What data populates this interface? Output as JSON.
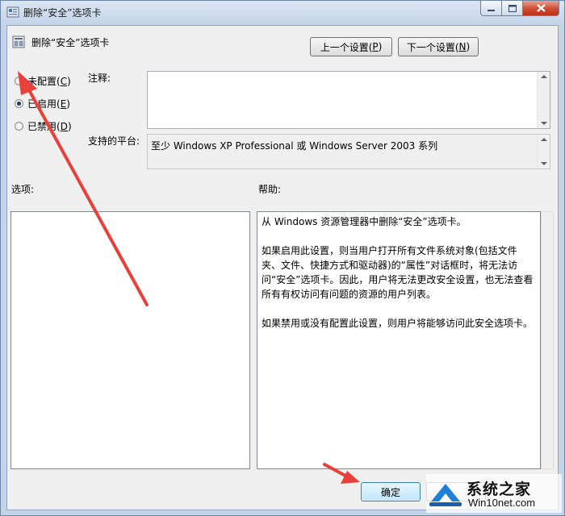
{
  "window": {
    "title": "删除“安全”选项卡"
  },
  "header": {
    "policy_title": "删除“安全”选项卡",
    "prev_label": "上一个设置(",
    "prev_key": "P",
    "next_label": "下一个设置(",
    "next_key": "N",
    "close_paren": ")"
  },
  "state": {
    "options": [
      {
        "label": "未配置(",
        "key": "C",
        "end": ")",
        "checked": false
      },
      {
        "label": "已启用(",
        "key": "E",
        "end": ")",
        "checked": true
      },
      {
        "label": "已禁用(",
        "key": "D",
        "end": ")",
        "checked": false
      }
    ]
  },
  "comment": {
    "label": "注释:",
    "value": ""
  },
  "platform": {
    "label": "支持的平台:",
    "value": "至少 Windows XP Professional 或 Windows Server 2003 系列"
  },
  "options_section": {
    "label": "选项:"
  },
  "help": {
    "label": "帮助:",
    "paragraphs": [
      "从 Windows 资源管理器中删除“安全”选项卡。",
      "如果启用此设置，则当用户打开所有文件系统对象(包括文件夹、文件、快捷方式和驱动器)的“属性”对话框时，将无法访问“安全”选项卡。因此，用户将无法更改安全设置，也无法查看所有有权访问有问题的资源的用户列表。",
      "如果禁用或没有配置此设置，则用户将能够访问此安全选项卡。"
    ]
  },
  "footer": {
    "ok_label": "确定"
  },
  "watermark": {
    "name": "系统之家",
    "url": "Win10net.com"
  },
  "colors": {
    "annotation_arrow": "#e8403a",
    "ok_focus": "#3c7fb1",
    "titlebar_close": "#c0321a"
  }
}
